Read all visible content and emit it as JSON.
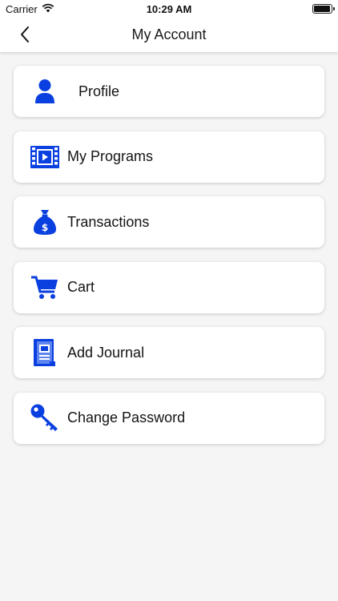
{
  "status_bar": {
    "carrier": "Carrier",
    "time": "10:29 AM"
  },
  "nav": {
    "title": "My Account",
    "back_icon": "chevron-left-icon"
  },
  "accent_color": "#0a3fe0",
  "menu": [
    {
      "label": "Profile",
      "icon": "person-icon"
    },
    {
      "label": "My Programs",
      "icon": "video-film-icon"
    },
    {
      "label": "Transactions",
      "icon": "money-bag-icon"
    },
    {
      "label": "Cart",
      "icon": "shopping-cart-icon"
    },
    {
      "label": "Add Journal",
      "icon": "journal-book-icon"
    },
    {
      "label": "Change Password",
      "icon": "key-icon"
    }
  ]
}
